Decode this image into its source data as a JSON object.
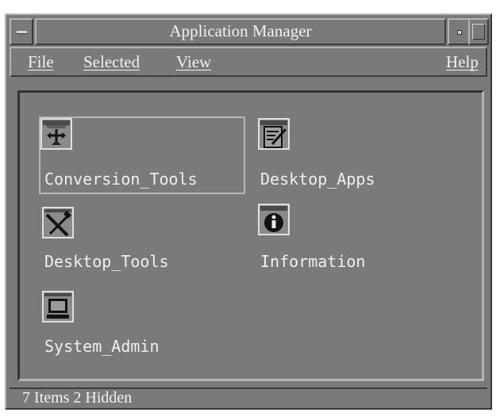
{
  "window": {
    "title": "Application Manager"
  },
  "menubar": {
    "file": "File",
    "selected": "Selected",
    "view": "View",
    "help": "Help"
  },
  "items": [
    {
      "label": "Conversion_Tools",
      "icon": "conversion-tools-icon",
      "selected": true
    },
    {
      "label": "Desktop_Apps",
      "icon": "desktop-apps-icon",
      "selected": false
    },
    {
      "label": "Desktop_Tools",
      "icon": "desktop-tools-icon",
      "selected": false
    },
    {
      "label": "Information",
      "icon": "information-icon",
      "selected": false
    },
    {
      "label": "System_Admin",
      "icon": "system-admin-icon",
      "selected": false
    }
  ],
  "status": {
    "text": "7 Items 2 Hidden"
  },
  "colors": {
    "background": "#7a7a7a",
    "text": "#f2f2f2",
    "bevel_light": "#b4b4b4",
    "bevel_dark": "#3c3c3c"
  }
}
